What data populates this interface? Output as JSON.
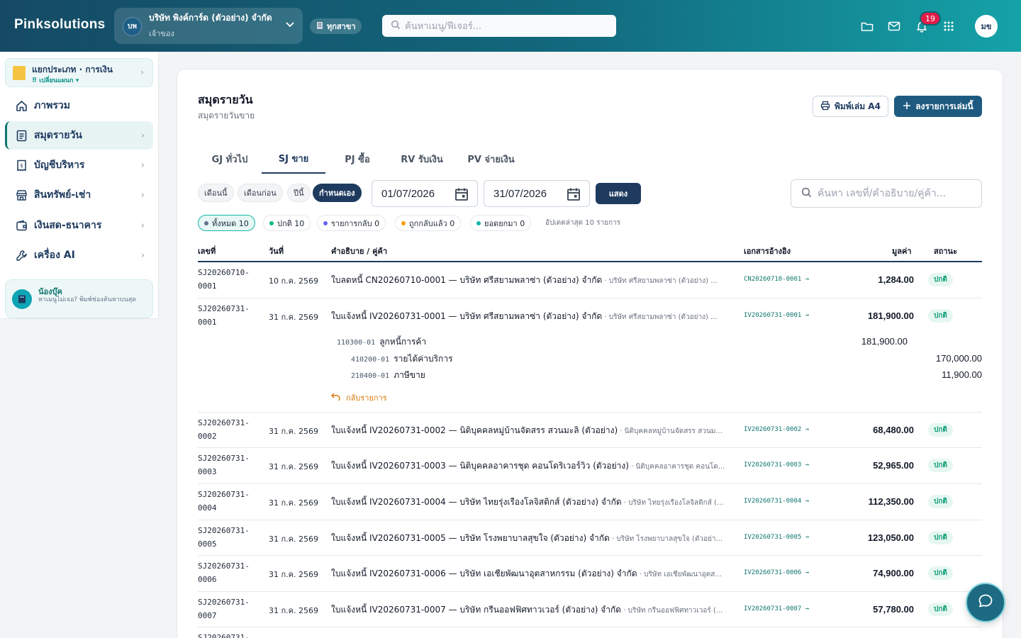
{
  "brand": "Pinksolutions",
  "company": {
    "initials": "บพ",
    "name": "บริษัท พิงค์การ์ด (ตัวอย่าง) จำกัด",
    "role": "เจ้าของ"
  },
  "branch": "ทุกสาขา",
  "top_search_placeholder": "ค้นหาเมนู/ฟีเจอร์...",
  "notifications": "19",
  "user_initials": "มข",
  "sidebar": {
    "switcher": {
      "title": "แยกประเภท · การเงิน",
      "sub": "⠿ เปลี่ยนแผนก ▾"
    },
    "items": [
      {
        "label": "ภาพรวม"
      },
      {
        "label": "สมุดรายวัน"
      },
      {
        "label": "บัญชีบริหาร"
      },
      {
        "label": "สินทรัพย์-เช่า"
      },
      {
        "label": "เงินสด-ธนาคาร"
      },
      {
        "label": "เครื่อง AI"
      }
    ],
    "helper": {
      "title": "น้องบุ๊ค",
      "text": "หาเมนูไม่เจอ? พิมพ์ช่องค้นหาบนสุด"
    }
  },
  "page": {
    "title": "สมุดรายวัน",
    "subtitle": "สมุดรายวันขาย",
    "print_label": "พิมพ์เล่ม A4",
    "add_label": "ลงรายการเล่มนี้"
  },
  "tabs": [
    "GJ ทั่วไป",
    "SJ ขาย",
    "PJ ซื้อ",
    "RV รับเงิน",
    "PV จ่ายเงิน"
  ],
  "filters": {
    "periods": [
      "เดือนนี้",
      "เดือนก่อน",
      "ปีนี้",
      "กำหนดเอง"
    ],
    "date_from": "01/07/2026",
    "date_to": "31/07/2026",
    "show_label": "แสดง",
    "search_placeholder": "ค้นหา เลขที่/คำอธิบาย/คู่ค้า..."
  },
  "status_filters": [
    {
      "label": "ทั้งหมด 10",
      "color": "#64748b"
    },
    {
      "label": "ปกติ 10",
      "color": "#10b981"
    },
    {
      "label": "รายการกลับ 0",
      "color": "#6366f1"
    },
    {
      "label": "ถูกกลับแล้ว 0",
      "color": "#f59e0b"
    },
    {
      "label": "ยอดยกมา 0",
      "color": "#14b8a6"
    }
  ],
  "updated_text": "อัปเดตล่าสุด 10 รายการ",
  "columns": {
    "no": "เลขที่",
    "date": "วันที่",
    "desc": "คำอธิบาย / คู่ค้า",
    "ref": "เอกสารอ้างอิง",
    "amount": "มูลค่า",
    "status": "สถานะ"
  },
  "rows": [
    {
      "no": "SJ20260710-\n0001",
      "date": "10 ก.ค. 2569",
      "desc": "ใบลดหนี้ CN20260710-0001 — บริษัท ศรีสยามพลาซ่า (ตัวอย่าง) จำกัด",
      "party": " · บริษัท ศรีสยามพลาซ่า (ตัวอย่าง) ...",
      "ref": "CN20260710-0001 →",
      "amount": "1,284.00",
      "status": "ปกติ"
    },
    {
      "no": "SJ20260731-\n0001",
      "date": "31 ก.ค. 2569",
      "desc": "ใบแจ้งหนี้ IV20260731-0001 — บริษัท ศรีสยามพลาซ่า (ตัวอย่าง) จำกัด",
      "party": " · บริษัท ศรีสยามพลาซ่า (ตัวอย่าง) ...",
      "ref": "IV20260731-0001 →",
      "amount": "181,900.00",
      "status": "ปกติ"
    },
    {
      "no": "SJ20260731-\n0002",
      "date": "31 ก.ค. 2569",
      "desc": "ใบแจ้งหนี้ IV20260731-0002 — นิติบุคคลหมู่บ้านจัดสรร สวนมะลิ (ตัวอย่าง)",
      "party": " · นิติบุคคลหมู่บ้านจัดสรร สวนม...",
      "ref": "IV20260731-0002 →",
      "amount": "68,480.00",
      "status": "ปกติ"
    },
    {
      "no": "SJ20260731-\n0003",
      "date": "31 ก.ค. 2569",
      "desc": "ใบแจ้งหนี้ IV20260731-0003 — นิติบุคคลอาคารชุด คอนโดริเวอร์วิว (ตัวอย่าง)",
      "party": " · นิติบุคคลอาคารชุด คอนโด...",
      "ref": "IV20260731-0003 →",
      "amount": "52,965.00",
      "status": "ปกติ"
    },
    {
      "no": "SJ20260731-\n0004",
      "date": "31 ก.ค. 2569",
      "desc": "ใบแจ้งหนี้ IV20260731-0004 — บริษัท ไทยรุ่งเรืองโลจิสติกส์ (ตัวอย่าง) จำกัด",
      "party": " · บริษัท ไทยรุ่งเรืองโลจิสติกส์ (...",
      "ref": "IV20260731-0004 →",
      "amount": "112,350.00",
      "status": "ปกติ"
    },
    {
      "no": "SJ20260731-\n0005",
      "date": "31 ก.ค. 2569",
      "desc": "ใบแจ้งหนี้ IV20260731-0005 — บริษัท โรงพยาบาลสุขใจ (ตัวอย่าง) จำกัด",
      "party": " · บริษัท โรงพยาบาลสุขใจ (ตัวอย่า...",
      "ref": "IV20260731-0005 →",
      "amount": "123,050.00",
      "status": "ปกติ"
    },
    {
      "no": "SJ20260731-\n0006",
      "date": "31 ก.ค. 2569",
      "desc": "ใบแจ้งหนี้ IV20260731-0006 — บริษัท เอเชียพัฒนาอุตสาหกรรม (ตัวอย่าง) จำกัด",
      "party": " · บริษัท เอเชียพัฒนาอุตส...",
      "ref": "IV20260731-0006 →",
      "amount": "74,900.00",
      "status": "ปกติ"
    },
    {
      "no": "SJ20260731-\n0007",
      "date": "31 ก.ค. 2569",
      "desc": "ใบแจ้งหนี้ IV20260731-0007 — บริษัท กรีนออฟฟิศทาวเวอร์ (ตัวอย่าง) จำกัด",
      "party": " · บริษัท กรีนออฟฟิศทาวเวอร์ (...",
      "ref": "IV20260731-0007 →",
      "amount": "57,780.00",
      "status": "ปกติ"
    },
    {
      "no": "SJ20260731-",
      "date": "",
      "desc": "",
      "party": "",
      "ref": "",
      "amount": "",
      "status": ""
    }
  ],
  "journal_lines": [
    {
      "code": "110300-01",
      "name": "ลูกหนี้การค้า",
      "debit": "181,900.00",
      "credit": ""
    },
    {
      "code": "410200-01",
      "name": "รายได้ค่าบริการ",
      "debit": "",
      "credit": "170,000.00"
    },
    {
      "code": "210400-01",
      "name": "ภาษีขาย",
      "debit": "",
      "credit": "11,900.00"
    }
  ],
  "back_label": "กลับรายการ",
  "colors": {
    "primary": "#1e3a5f",
    "accent": "#0f766e",
    "status_ok": "#0f9d76"
  }
}
